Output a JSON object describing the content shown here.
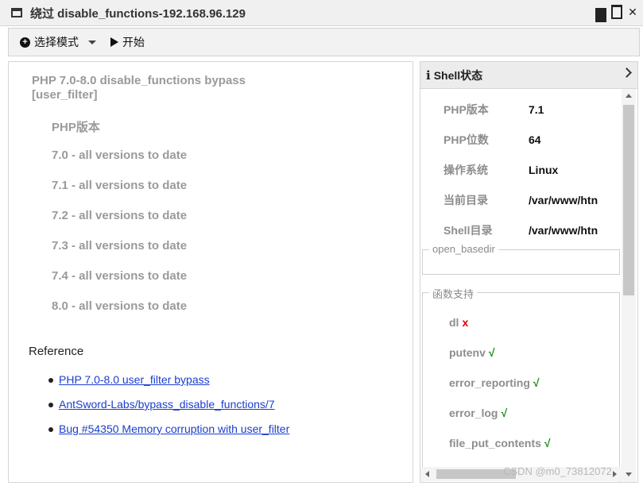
{
  "window": {
    "title": "绕过 disable_functions-192.168.96.129",
    "controls": {
      "minimize": "_",
      "maximize": "□",
      "close": "✕"
    }
  },
  "toolbar": {
    "mode_label": "选择模式",
    "start_label": "开始"
  },
  "left": {
    "title": "PHP 7.0-8.0 disable_functions bypass [user_filter]",
    "version_header": "PHP版本",
    "versions": [
      "7.0 - all versions to date",
      "7.1 - all versions to date",
      "7.2 - all versions to date",
      "7.3 - all versions to date",
      "7.4 - all versions to date",
      "8.0 - all versions to date"
    ],
    "reference_title": "Reference",
    "references": [
      "PHP 7.0-8.0 user_filter bypass",
      "AntSword-Labs/bypass_disable_functions/7",
      "Bug #54350 Memory corruption with user_filter"
    ]
  },
  "shell": {
    "title": "Shell状态",
    "info": [
      {
        "key": "PHP版本",
        "value": "7.1"
      },
      {
        "key": "PHP位数",
        "value": "64"
      },
      {
        "key": "操作系统",
        "value": "Linux"
      },
      {
        "key": "当前目录",
        "value": "/var/www/htn"
      },
      {
        "key": "Shell目录",
        "value": "/var/www/htn"
      }
    ],
    "open_basedir_label": "open_basedir",
    "func_support_label": "函数支持",
    "functions": [
      {
        "name": "dl",
        "mark": "x",
        "ok": false
      },
      {
        "name": "putenv",
        "mark": "√",
        "ok": true
      },
      {
        "name": "error_reporting",
        "mark": "√",
        "ok": true
      },
      {
        "name": "error_log",
        "mark": "√",
        "ok": true
      },
      {
        "name": "file_put_contents",
        "mark": "√",
        "ok": true
      }
    ]
  },
  "watermark": "CSDN @m0_73812072",
  "colors": {
    "link": "#1a3fcc",
    "ok": "#118811",
    "fail": "#dd0000",
    "muted": "#9a9a9a"
  }
}
